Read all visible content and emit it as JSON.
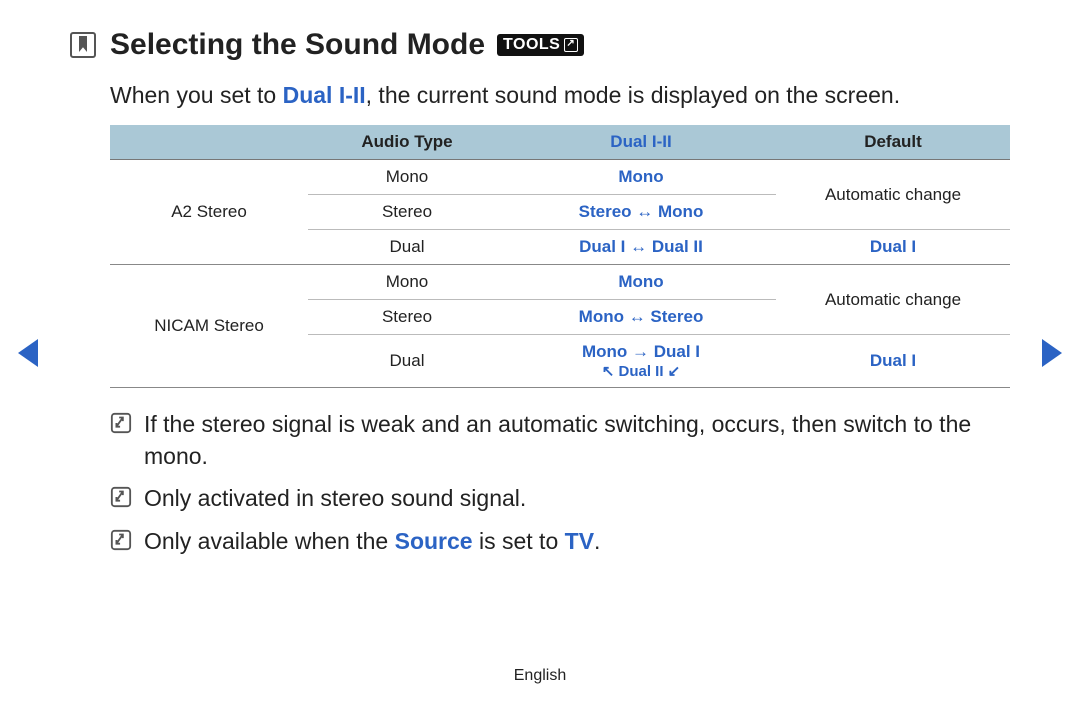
{
  "title": "Selecting the Sound Mode",
  "tools_badge": "TOOLS",
  "intro_prefix": "When you set to ",
  "intro_highlight": "Dual I-II",
  "intro_suffix": ", the current sound mode is displayed on the screen.",
  "table": {
    "headers": {
      "col1": "",
      "col2": "Audio Type",
      "col3": "Dual I-II",
      "col4": "Default"
    },
    "group1": {
      "label": "A2 Stereo",
      "rows": [
        {
          "audio": "Mono",
          "dual": "Mono",
          "default": ""
        },
        {
          "audio": "Stereo",
          "dual": "Stereo ↔ Mono",
          "default": ""
        },
        {
          "audio": "Dual",
          "dual": "Dual I ↔ Dual II",
          "default": "Dual I"
        }
      ],
      "default_merged": "Automatic change"
    },
    "group2": {
      "label": "NICAM Stereo",
      "rows": [
        {
          "audio": "Mono",
          "dual": "Mono",
          "default": ""
        },
        {
          "audio": "Stereo",
          "dual": "Mono ↔ Stereo",
          "default": ""
        }
      ],
      "dual_row_line1": "Mono → Dual I",
      "dual_row_line2": "↖ Dual II ↙",
      "dual_row_audio": "Dual",
      "dual_row_default": "Dual I",
      "default_merged": "Automatic change"
    }
  },
  "notes": {
    "n1": "If the stereo signal is weak and an automatic switching, occurs, then switch to the mono.",
    "n2": "Only activated in stereo sound signal.",
    "n3_prefix": "Only available when the ",
    "n3_source": "Source",
    "n3_mid": " is set to ",
    "n3_tv": "TV",
    "n3_suffix": "."
  },
  "footer": "English"
}
